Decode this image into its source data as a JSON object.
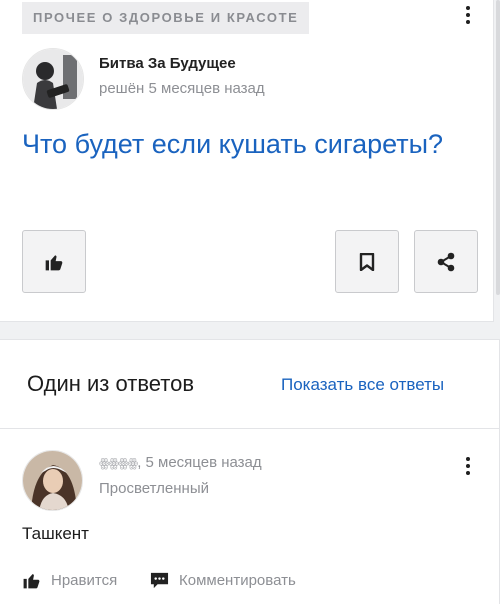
{
  "question": {
    "category": "ПРОЧЕЕ О ЗДОРОВЬЕ И КРАСОТЕ",
    "author": "Битва За Будущее",
    "meta": "решён 5 месяцев назад",
    "title": "Что будет если кушать сигареты?",
    "icons": {
      "like": "thumbs-up-icon",
      "bookmark": "bookmark-icon",
      "share": "share-icon",
      "menu": "more-vertical-icon"
    }
  },
  "answers": {
    "heading": "Один из ответов",
    "show_all": "Показать все ответы",
    "item": {
      "nickname": "ꙮꙮꙮꙮ",
      "time": ", 5 месяцев назад",
      "rank": "Просветленный",
      "text": "Ташкент",
      "like_label": "Нравится",
      "comment_label": "Комментировать"
    }
  },
  "colors": {
    "accent": "#1a63bf",
    "muted": "#8d8f94"
  }
}
